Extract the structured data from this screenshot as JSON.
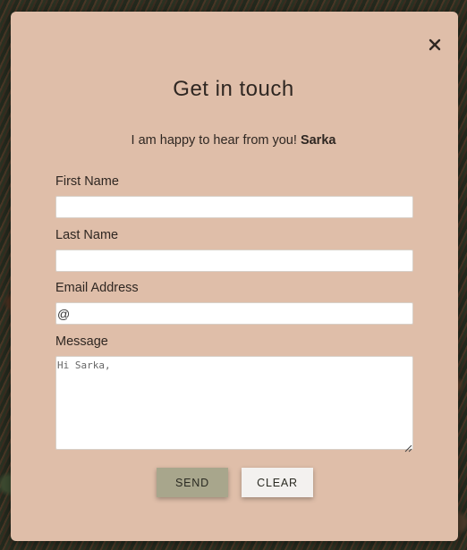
{
  "dialog": {
    "title": "Get in touch",
    "subtitle_text": "I am happy to hear from you! ",
    "subtitle_name": "Sarka",
    "close_icon": "close-icon"
  },
  "form": {
    "first_name": {
      "label": "First Name",
      "value": "",
      "placeholder": ""
    },
    "last_name": {
      "label": "Last Name",
      "value": "",
      "placeholder": ""
    },
    "email": {
      "label": "Email Address",
      "value": "",
      "placeholder": "@"
    },
    "message": {
      "label": "Message",
      "value": "",
      "placeholder": "Hi Sarka,"
    }
  },
  "buttons": {
    "send": "SEND",
    "clear": "CLEAR"
  },
  "colors": {
    "modal_background": "#dfbea9",
    "send_button": "#a8a68c",
    "clear_button": "#f3f1ef",
    "text": "#2f2722"
  }
}
